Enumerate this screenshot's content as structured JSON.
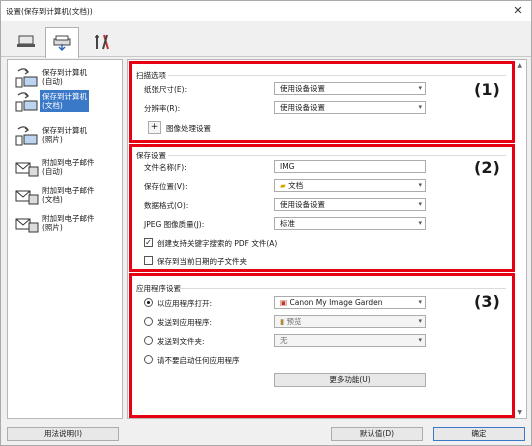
{
  "window": {
    "title": "设置(保存到计算机(文档))",
    "close_icon": "✕"
  },
  "tabs": [
    {
      "name": "scan-tab",
      "icon": "scanner-icon"
    },
    {
      "name": "save-tab",
      "icon": "scan-save-icon"
    },
    {
      "name": "general-tab",
      "icon": "tools-icon"
    }
  ],
  "sidebar": {
    "items": [
      {
        "label": "保存到计算机\n(自动)",
        "icon": "computer-save-icon"
      },
      {
        "label": "保存到计算机\n(文档)",
        "icon": "computer-save-icon"
      },
      {
        "label": "保存到计算机\n(照片)",
        "icon": "computer-save-icon"
      },
      {
        "label": "附加到电子邮件\n(自动)",
        "icon": "email-icon"
      },
      {
        "label": "附加到电子邮件\n(文档)",
        "icon": "email-icon"
      },
      {
        "label": "附加到电子邮件\n(照片)",
        "icon": "email-icon"
      }
    ]
  },
  "scan_options": {
    "title": "扫描选项",
    "paper_size_label": "纸张尺寸(E):",
    "paper_size_value": "使用设备设置",
    "resolution_label": "分辨率(R):",
    "resolution_value": "使用设备设置",
    "image_processing_label": "图像处理设置",
    "marker": "(1)"
  },
  "save_settings": {
    "title": "保存设置",
    "file_name_label": "文件名称(F):",
    "file_name_value": "IMG",
    "save_in_label": "保存位置(V):",
    "save_in_value": "文档",
    "data_format_label": "数据格式(O):",
    "data_format_value": "使用设备设置",
    "jpeg_quality_label": "JPEG 图像质量(J):",
    "jpeg_quality_value": "标准",
    "pdf_keyword_label": "创建支持关键字搜索的 PDF 文件(A)",
    "subfolder_label": "保存到当前日期的子文件夹",
    "marker": "(2)"
  },
  "app_settings": {
    "title": "应用程序设置",
    "open_with_label": "以应用程序打开:",
    "open_with_value": "Canon My Image Garden",
    "send_to_app_label": "发送到应用程序:",
    "send_to_app_value": "预览",
    "send_to_folder_label": "发送到文件夹:",
    "send_to_folder_value": "无",
    "do_not_start_label": "请不要启动任何应用程序",
    "more_functions_label": "更多功能(U)",
    "marker": "(3)"
  },
  "footer": {
    "instructions_label": "用法说明(I)",
    "defaults_label": "默认值(D)",
    "ok_label": "确定"
  },
  "colors": {
    "highlight": "#e60012",
    "selection": "#3a78c8"
  }
}
